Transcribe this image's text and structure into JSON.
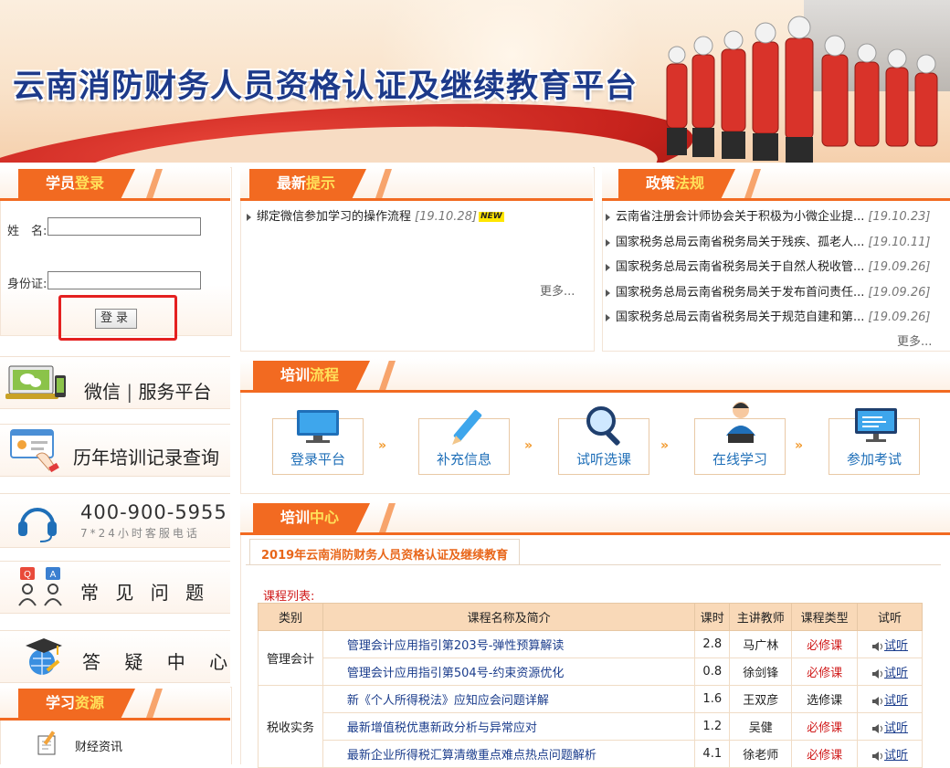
{
  "banner": {
    "title": "云南消防财务人员资格认证及继续教育平台"
  },
  "login": {
    "header": {
      "pre": "学员",
      "hl": "登录"
    },
    "name_label": "姓　名:",
    "id_label": "身份证:",
    "name_value": "",
    "id_value": "",
    "button": "登录"
  },
  "left_links": {
    "wechat_pre": "微信",
    "wechat_sep": "|",
    "wechat_post": "服务平台",
    "records": "历年培训记录查询",
    "phone": "400-900-5955",
    "phone_sub": "7*24小时客服电话",
    "faq": "常 见 问 题",
    "qa": "答 疑 中 心",
    "resources_header": {
      "pre": "学习",
      "hl": "资源"
    },
    "resource_item": "财经资讯"
  },
  "tips": {
    "header": {
      "pre": "最新",
      "hl": "提示"
    },
    "items": [
      {
        "title": "绑定微信参加学习的操作流程",
        "date": "[19.10.28]",
        "badge": "NEW"
      }
    ],
    "more": "更多..."
  },
  "policy": {
    "header": {
      "pre": "政策",
      "hl": "法规"
    },
    "items": [
      {
        "title": "云南省注册会计师协会关于积极为小微企业提...",
        "date": "[19.10.23]"
      },
      {
        "title": "国家税务总局云南省税务局关于残疾、孤老人...",
        "date": "[19.10.11]"
      },
      {
        "title": "国家税务总局云南省税务局关于自然人税收管...",
        "date": "[19.09.26]"
      },
      {
        "title": "国家税务总局云南省税务局关于发布首问责任...",
        "date": "[19.09.26]"
      },
      {
        "title": "国家税务总局云南省税务局关于规范自建和第...",
        "date": "[19.09.26]"
      }
    ],
    "more": "更多..."
  },
  "process": {
    "header": {
      "pre": "培训",
      "hl": "流程"
    },
    "arrow": "»",
    "steps": [
      "登录平台",
      "补充信息",
      "试听选课",
      "在线学习",
      "参加考试"
    ]
  },
  "center": {
    "header": {
      "pre": "培训",
      "hl": "中心"
    },
    "tab": "2019年云南消防财务人员资格认证及继续教育",
    "list_label": "课程列表:",
    "columns": [
      "类别",
      "课程名称及简介",
      "课时",
      "主讲教师",
      "课程类型",
      "试听"
    ],
    "groups": [
      {
        "category": "管理会计",
        "rows": [
          {
            "name": "管理会计应用指引第203号-弹性预算解读",
            "hours": "2.8",
            "teacher": "马广林",
            "type": "必修课",
            "listen": "试听"
          },
          {
            "name": "管理会计应用指引第504号-约束资源优化",
            "hours": "0.8",
            "teacher": "徐剑锋",
            "type": "必修课",
            "listen": "试听"
          }
        ]
      },
      {
        "category": "税收实务",
        "rows": [
          {
            "name": "新《个人所得税法》应知应会问题详解",
            "hours": "1.6",
            "teacher": "王双彦",
            "type": "选修课",
            "listen": "试听"
          },
          {
            "name": "最新增值税优惠新政分析与异常应对",
            "hours": "1.2",
            "teacher": "吴健",
            "type": "必修课",
            "listen": "试听"
          },
          {
            "name": "最新企业所得税汇算清缴重点难点热点问题解析",
            "hours": "4.1",
            "teacher": "徐老师",
            "type": "必修课",
            "listen": "试听"
          }
        ]
      }
    ]
  }
}
